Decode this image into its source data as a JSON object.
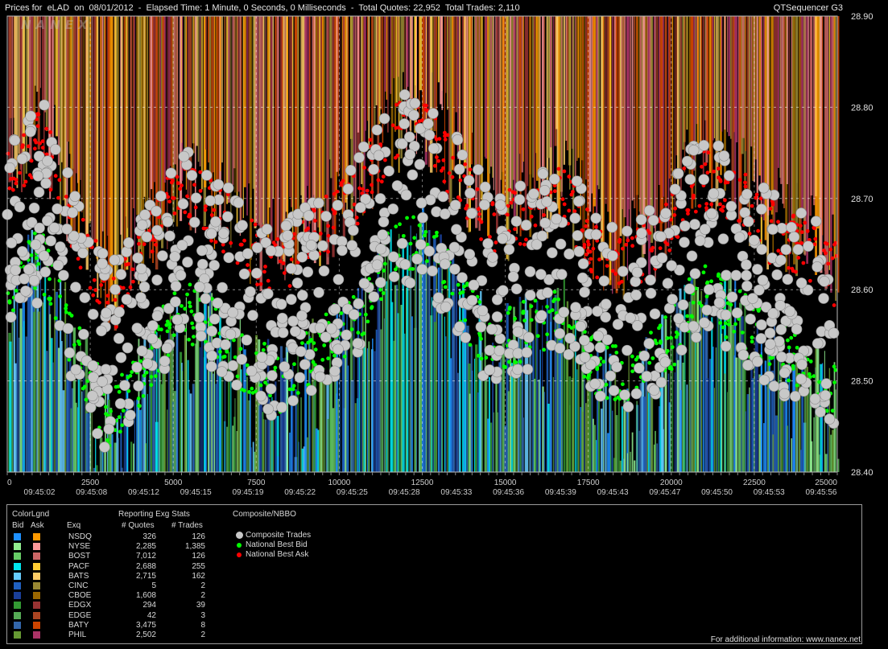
{
  "header": {
    "title": "Prices for  eLAD  on  08/01/2012  -  Elapsed Time: 1 Minute, 0 Seconds, 0 Milliseconds  -  Total Quotes: 22,952  Total Trades: 2,110",
    "app_name": "QTSequencer G3",
    "watermark": "NANEX"
  },
  "chart_data": {
    "type": "scatter",
    "title": "Prices for eLAD on 08/01/2012",
    "ylim": [
      28.4,
      28.9
    ],
    "y_ticks": [
      "28.90",
      "28.80",
      "28.70",
      "28.60",
      "28.50",
      "28.40"
    ],
    "xlim": [
      0,
      25000
    ],
    "x_ticks": [
      "0",
      "2500",
      "5000",
      "7500",
      "10000",
      "12500",
      "15000",
      "17500",
      "20000",
      "22500",
      "25000"
    ],
    "time_ticks": [
      "09:45:02",
      "09:45:08",
      "09:45:12",
      "09:45:15",
      "09:45:19",
      "09:45:22",
      "09:45:25",
      "09:45:28",
      "09:45:33",
      "09:45:36",
      "09:45:39",
      "09:45:43",
      "09:45:47",
      "09:45:50",
      "09:45:53",
      "09:45:56"
    ],
    "grid": true,
    "series": [
      {
        "name": "Composite Trades",
        "color": "#c8c8c8"
      },
      {
        "name": "National Best Bid",
        "color": "#00ff00"
      },
      {
        "name": "National Best Ask",
        "color": "#ff0000"
      }
    ]
  },
  "legend": {
    "color_legend_label": "ColorLgnd",
    "bid_label": "Bid",
    "ask_label": "Ask",
    "exg_col_label": "Exq",
    "stats_title": "Reporting Exg Stats",
    "quotes_col_label": "# Quotes",
    "trades_col_label": "# Trades",
    "composite_title": "Composite/NBBO",
    "rows": [
      {
        "exg": "NSDQ",
        "quotes": "326",
        "trades": "126",
        "bid_color": "#1e90ff",
        "ask_color": "#ff9900"
      },
      {
        "exg": "NYSE",
        "quotes": "2,285",
        "trades": "1,385",
        "bid_color": "#90ee90",
        "ask_color": "#ff9999"
      },
      {
        "exg": "BOST",
        "quotes": "7,012",
        "trades": "126",
        "bid_color": "#66cc66",
        "ask_color": "#cc6666"
      },
      {
        "exg": "PACF",
        "quotes": "2,688",
        "trades": "255",
        "bid_color": "#00e5ee",
        "ask_color": "#ffcc33"
      },
      {
        "exg": "BATS",
        "quotes": "2,715",
        "trades": "162",
        "bid_color": "#66ccff",
        "ask_color": "#ffcc66"
      },
      {
        "exg": "CINC",
        "quotes": "5",
        "trades": "2",
        "bid_color": "#2060c0",
        "ask_color": "#998833"
      },
      {
        "exg": "CBOE",
        "quotes": "1,608",
        "trades": "2",
        "bid_color": "#1a3f99",
        "ask_color": "#996600"
      },
      {
        "exg": "EDGX",
        "quotes": "294",
        "trades": "39",
        "bid_color": "#339933",
        "ask_color": "#993333"
      },
      {
        "exg": "EDGE",
        "quotes": "42",
        "trades": "3",
        "bid_color": "#55aa55",
        "ask_color": "#aa4422"
      },
      {
        "exg": "BATY",
        "quotes": "3,475",
        "trades": "8",
        "bid_color": "#3366aa",
        "ask_color": "#cc4400"
      },
      {
        "exg": "PHIL",
        "quotes": "2,502",
        "trades": "2",
        "bid_color": "#669933",
        "ask_color": "#aa3366"
      }
    ],
    "composite_items": [
      {
        "label": "Composite Trades",
        "color": "#c8c8c8"
      },
      {
        "label": "National Best Bid",
        "color": "#00ff00"
      },
      {
        "label": "National Best Ask",
        "color": "#ff0000"
      }
    ]
  },
  "footer": {
    "text": "For additional information: www.nanex.net"
  }
}
